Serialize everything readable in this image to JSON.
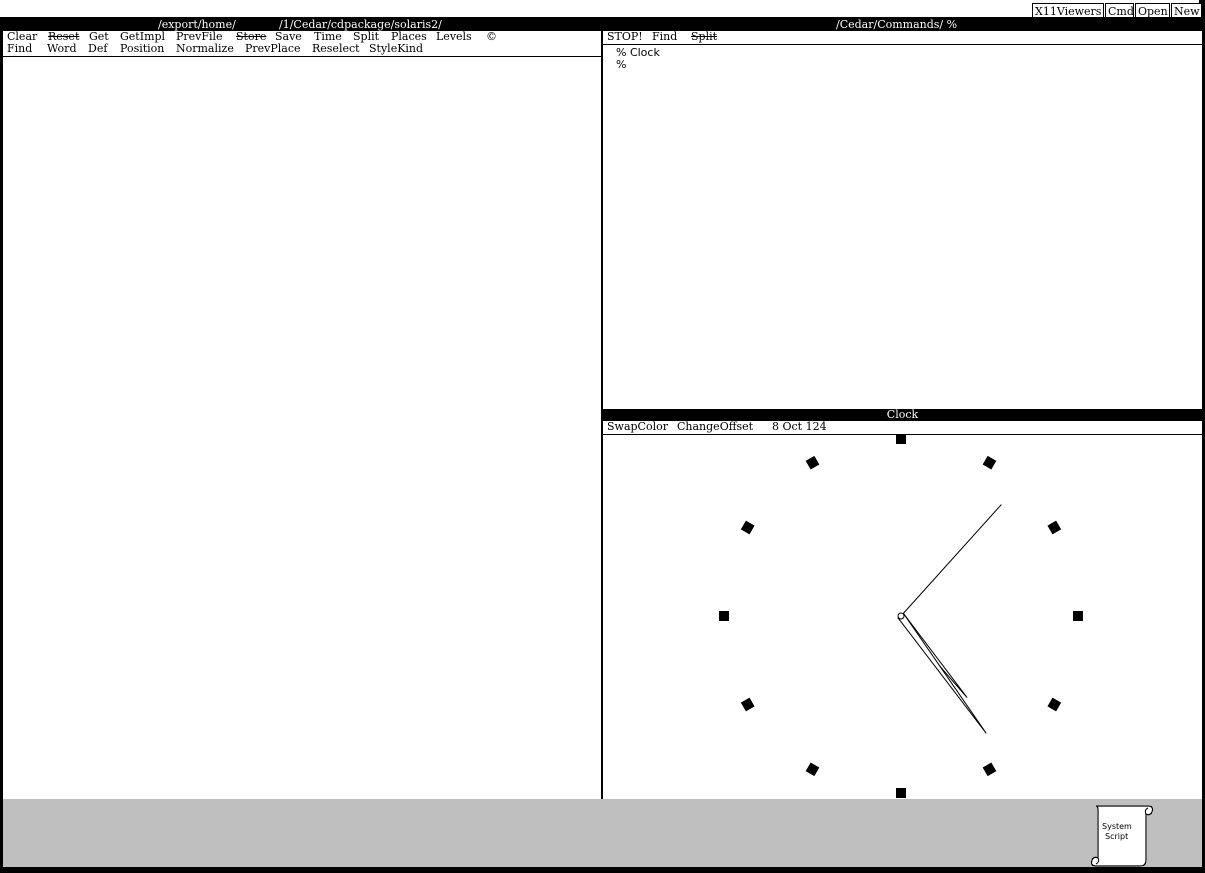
{
  "top_buttons": [
    "X11Viewers",
    "Cmd",
    "Open",
    "New"
  ],
  "left_viewer": {
    "title_prefix": "/export/home/",
    "title_suffix": "/1/Cedar/cdpackage/solaris2/",
    "menu_row1": [
      "Clear",
      "Reset",
      "Get",
      "GetImpl",
      "PrevFile",
      "Store",
      "Save",
      "Time",
      "Split",
      "Places",
      "Levels",
      "©"
    ],
    "menu_row2": [
      "Find",
      "Word",
      "Def",
      "Position",
      "Normalize",
      "PrevPlace",
      "Reselect",
      "StyleKind"
    ]
  },
  "command_viewer": {
    "title": "/Cedar/Commands/ %",
    "menu": [
      "STOP!",
      "Find",
      "Split"
    ],
    "lines": [
      "% Clock",
      "%"
    ]
  },
  "clock_viewer": {
    "title": "Clock",
    "menu": [
      "SwapColor",
      "ChangeOffset",
      "8 Oct 124"
    ],
    "hands": {
      "hour": 4.7,
      "minute": 24,
      "second": 7
    }
  },
  "desktop": {
    "icon_label_line1": "System",
    "icon_label_line2": "Script"
  },
  "colors": {
    "background": "#000000",
    "window": "#ffffff",
    "text": "#000000"
  }
}
